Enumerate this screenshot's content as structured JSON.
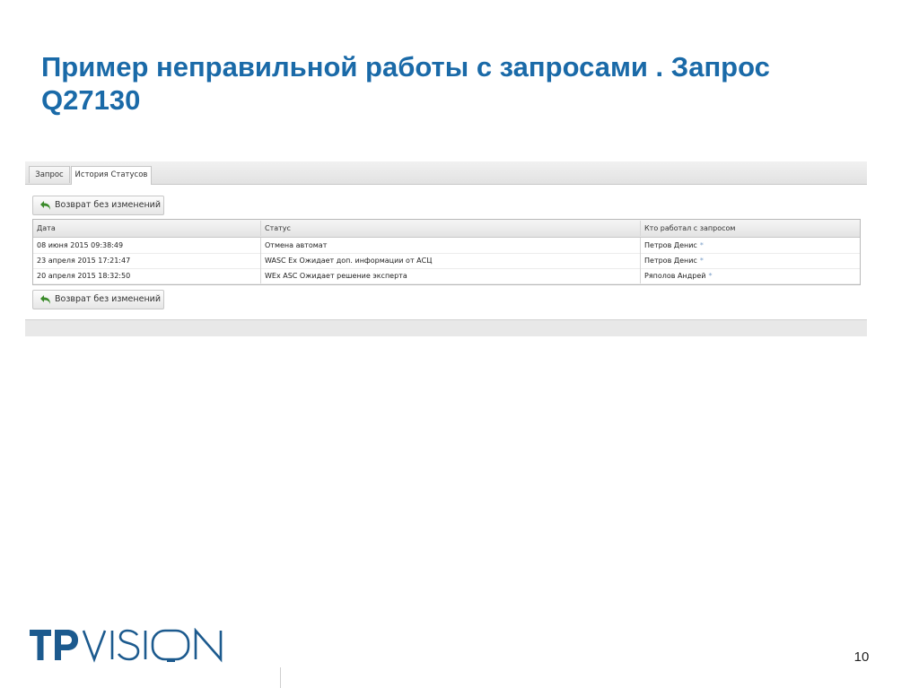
{
  "slide": {
    "title": "Пример неправильной работы с запросами . Запрос Q27130",
    "page_number": "10",
    "logo_text": "TPVISION"
  },
  "tabs": [
    {
      "label": "Запрос",
      "active": false
    },
    {
      "label": "История Статусов",
      "active": true
    }
  ],
  "toolbar": {
    "return_label": "Возврат без изменений",
    "icon": "undo-arrow-icon",
    "icon_color": "#3a8a2a"
  },
  "table": {
    "columns": [
      "Дата",
      "Статус",
      "Кто работал с запросом"
    ],
    "rows": [
      {
        "date": "08 июня 2015 09:38:49",
        "status": "Отмена автомат",
        "user": "Петров Денис",
        "mark": "*"
      },
      {
        "date": "23 апреля 2015 17:21:47",
        "status": "WASC Ex Ожидает доп. информации от АСЦ",
        "user": "Петров Денис",
        "mark": "*"
      },
      {
        "date": "20 апреля 2015 18:32:50",
        "status": "WEx ASC Ожидает решение эксперта",
        "user": "Ряполов Андрей",
        "mark": "*"
      }
    ]
  },
  "colors": {
    "title": "#1a6aa8",
    "logo": "#1c5a8e",
    "star": "#7b9fc8"
  }
}
